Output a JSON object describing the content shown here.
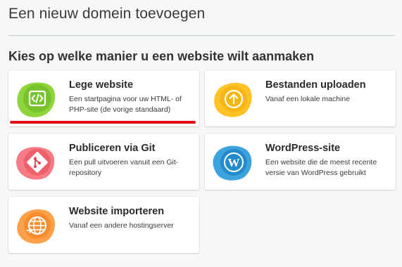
{
  "page": {
    "title": "Een nieuw domein toevoegen",
    "section_title": "Kies op welke manier u een website wilt aanmaken"
  },
  "cards": [
    {
      "id": "blank",
      "title": "Lege website",
      "description": "Een startpagina voor uw HTML- of PHP-site (de vorige standaard)",
      "icon": "code-icon",
      "blob_color": "#8ed53c",
      "blob_color_dark": "#63b522"
    },
    {
      "id": "upload",
      "title": "Bestanden uploaden",
      "description": "Vanaf een lokale machine",
      "icon": "upload-icon",
      "blob_color": "#ffc227",
      "blob_color_dark": "#f0a800"
    },
    {
      "id": "git",
      "title": "Publiceren via Git",
      "description": "Een pull uitvoeren vanuit een Git-repository",
      "icon": "git-icon",
      "blob_color": "#f77a84",
      "blob_color_dark": "#e3404f"
    },
    {
      "id": "wordpress",
      "title": "WordPress-site",
      "description": "Een website die de meest recente versie van WordPress gebruikt",
      "icon": "wordpress-icon",
      "blob_color": "#3ba3de",
      "blob_color_dark": "#1476b8"
    },
    {
      "id": "import",
      "title": "Website importeren",
      "description": "Vanaf een andere hostingserver",
      "icon": "globe-import-icon",
      "blob_color": "#ffa14a",
      "blob_color_dark": "#f27a14"
    }
  ],
  "highlight_color": "#e0101a"
}
